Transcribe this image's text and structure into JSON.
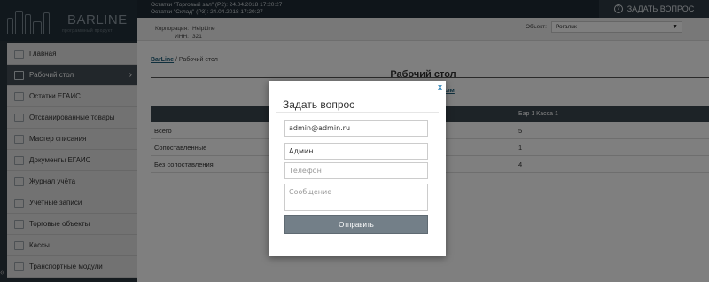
{
  "header": {
    "logo_text": "BARLINE",
    "logo_subtext": "программный продукт",
    "stock_lines": [
      "Остатки \"Торговый зал\" (Р2): 24.04.2018 17:20:27",
      "Остатки \"Склад\" (Р3): 24.04.2018 17:20:27"
    ],
    "ask_question_label": "ЗАДАТЬ ВОПРОС"
  },
  "infobar": {
    "corp_label": "Корпорация:",
    "corp_value": "HelpLine",
    "inn_label": "ИНН:",
    "inn_value": "321",
    "object_label": "Объект:",
    "object_value": "Рогалик"
  },
  "sidebar": {
    "items": [
      {
        "label": "Главная"
      },
      {
        "label": "Рабочий стол"
      },
      {
        "label": "Остатки ЕГАИС"
      },
      {
        "label": "Отсканированные товары"
      },
      {
        "label": "Мастер списания"
      },
      {
        "label": "Документы ЕГАИС"
      },
      {
        "label": "Журнал учёта"
      },
      {
        "label": "Учетные записи"
      },
      {
        "label": "Торговые объекты"
      },
      {
        "label": "Кассы"
      },
      {
        "label": "Транспортные модули"
      }
    ]
  },
  "main": {
    "breadcrumb_link": "BarLine",
    "breadcrumb_sep": "/",
    "breadcrumb_current": "Рабочий стол",
    "page_title": "Рабочий стол",
    "matched_link": "ленным",
    "table": {
      "header_col2": "Бар 1 Касса 1",
      "rows": [
        {
          "label": "Всего",
          "value": "5"
        },
        {
          "label": "Сопоставленные",
          "value": "1"
        },
        {
          "label": "Без сопоставления",
          "value": "4"
        }
      ]
    }
  },
  "modal": {
    "close_label": "x",
    "title": "Задать вопрос",
    "email_value": "admin@admin.ru",
    "name_value": "Админ",
    "phone_placeholder": "Телефон",
    "message_placeholder": "Сообщение",
    "submit_label": "Отправить"
  }
}
